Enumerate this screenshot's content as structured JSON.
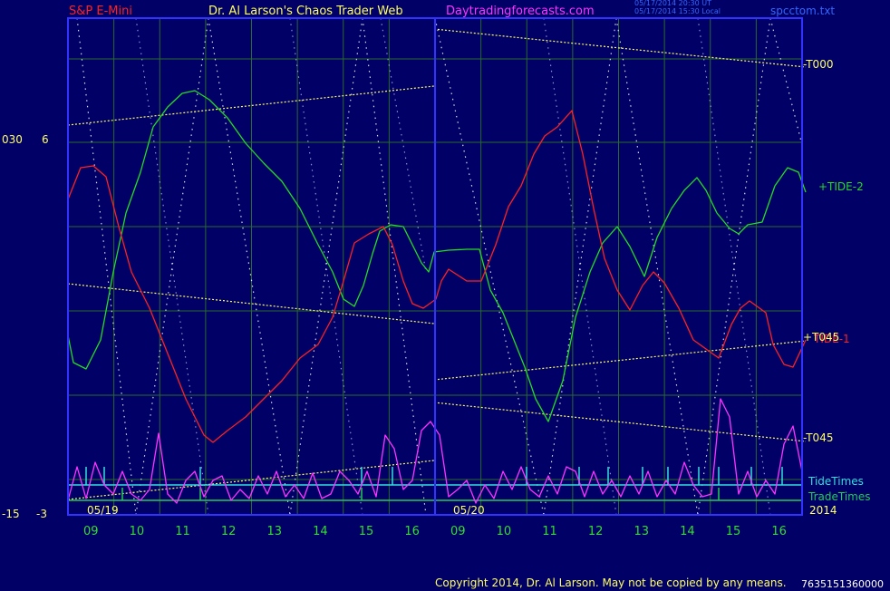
{
  "header": {
    "instrument": "S&P E-Mini",
    "source": "Dr. Al Larson's Chaos Trader Web",
    "site": "Daytradingforecasts.com",
    "stamp_line1": "05/17/2014 20:30 UT",
    "stamp_line2": "05/17/2014 15:30 Local",
    "file": "spcctom.txt"
  },
  "footer": {
    "copyright": "Copyright 2014, Dr. Al Larson. May not be copied by any means.",
    "code": "7635151360000"
  },
  "axis": {
    "left_top_a": "030",
    "left_top_b": "6",
    "left_bot_a": "-15",
    "left_bot_b": "-3",
    "year": "2014",
    "dates": [
      "05/19",
      "05/20"
    ]
  },
  "colors": {
    "background": "#000066",
    "frame": "#3333ff",
    "grid": "#2a6a2a",
    "tide1": "#ff2020",
    "tide2": "#22dd22",
    "eforce": "#ff33ff",
    "tidetimes": "#33dddd",
    "tradetimes": "#22cc55",
    "channel": "#ffff66"
  },
  "chart_data": {
    "type": "line",
    "x_ticks": [
      "09",
      "10",
      "11",
      "12",
      "13",
      "14",
      "15",
      "16",
      "09",
      "10",
      "11",
      "12",
      "13",
      "14",
      "15",
      "16"
    ],
    "x_hours": [
      8.5,
      9.5,
      10.5,
      11.5,
      12.5,
      13.5,
      14.5,
      15.5,
      16.5,
      17.5,
      18.5,
      19.5,
      20.5,
      21.5,
      22.5,
      23.5,
      24.5
    ],
    "labels": {
      "t000": "-T000",
      "tide2": "+TIDE-2",
      "tide1": "TIDE-1",
      "t045p": "+T045",
      "t045m": "-T045",
      "tidetimes": "TideTimes",
      "tradetimes": "TradeTimes"
    },
    "series": [
      {
        "name": "+TIDE-2",
        "color": "#22dd22",
        "points": [
          [
            0,
            370
          ],
          [
            0.3,
            400
          ],
          [
            1,
            407
          ],
          [
            1.8,
            375
          ],
          [
            2.5,
            300
          ],
          [
            3.2,
            235
          ],
          [
            4,
            190
          ],
          [
            4.7,
            140
          ],
          [
            5.5,
            118
          ],
          [
            6.3,
            103
          ],
          [
            7,
            100
          ],
          [
            7.8,
            110
          ],
          [
            8.8,
            130
          ],
          [
            9.8,
            158
          ],
          [
            10.8,
            180
          ],
          [
            11.8,
            200
          ],
          [
            12.8,
            230
          ],
          [
            13.8,
            270
          ],
          [
            14.6,
            300
          ],
          [
            15.2,
            330
          ],
          [
            15.8,
            338
          ],
          [
            16.3,
            315
          ],
          [
            16.8,
            280
          ],
          [
            17.2,
            255
          ],
          [
            17.8,
            248
          ],
          [
            18.5,
            250
          ],
          [
            19,
            270
          ],
          [
            19.5,
            290
          ],
          [
            19.9,
            300
          ],
          [
            20.2,
            278
          ],
          [
            21,
            276
          ],
          [
            22,
            275
          ],
          [
            22.7,
            275
          ],
          [
            23.3,
            320
          ],
          [
            24,
            345
          ],
          [
            24.6,
            375
          ],
          [
            25.2,
            405
          ],
          [
            25.8,
            440
          ],
          [
            26.5,
            465
          ],
          [
            27.3,
            420
          ],
          [
            28,
            350
          ],
          [
            28.8,
            300
          ],
          [
            29.5,
            268
          ],
          [
            30.3,
            250
          ],
          [
            31,
            272
          ],
          [
            31.8,
            305
          ],
          [
            32.5,
            262
          ],
          [
            33.3,
            230
          ],
          [
            34,
            210
          ],
          [
            34.7,
            196
          ],
          [
            35.2,
            210
          ],
          [
            35.8,
            235
          ],
          [
            36.5,
            252
          ],
          [
            37,
            258
          ],
          [
            37.5,
            248
          ],
          [
            38.3,
            245
          ],
          [
            39,
            205
          ],
          [
            39.7,
            185
          ],
          [
            40.3,
            190
          ],
          [
            40.7,
            212
          ]
        ]
      },
      {
        "name": "TIDE-1",
        "color": "#ff2020",
        "points": [
          [
            0,
            220
          ],
          [
            0.7,
            185
          ],
          [
            1.4,
            183
          ],
          [
            2.1,
            195
          ],
          [
            2.8,
            250
          ],
          [
            3.5,
            300
          ],
          [
            4.5,
            340
          ],
          [
            5.5,
            390
          ],
          [
            6.5,
            440
          ],
          [
            7.5,
            480
          ],
          [
            8,
            488
          ],
          [
            8.8,
            475
          ],
          [
            9.8,
            460
          ],
          [
            10.8,
            440
          ],
          [
            11.8,
            420
          ],
          [
            12.8,
            395
          ],
          [
            13.8,
            380
          ],
          [
            14.6,
            350
          ],
          [
            15.2,
            310
          ],
          [
            15.8,
            268
          ],
          [
            16.6,
            258
          ],
          [
            17.4,
            250
          ],
          [
            17.9,
            270
          ],
          [
            18.5,
            310
          ],
          [
            19,
            335
          ],
          [
            19.6,
            340
          ],
          [
            20.3,
            330
          ],
          [
            20.6,
            310
          ],
          [
            21,
            297
          ],
          [
            22,
            310
          ],
          [
            22.8,
            310
          ],
          [
            23.6,
            270
          ],
          [
            24.3,
            228
          ],
          [
            25,
            205
          ],
          [
            25.7,
            170
          ],
          [
            26.3,
            150
          ],
          [
            27,
            140
          ],
          [
            27.8,
            122
          ],
          [
            28.4,
            170
          ],
          [
            29,
            230
          ],
          [
            29.6,
            285
          ],
          [
            30.3,
            320
          ],
          [
            31,
            342
          ],
          [
            31.7,
            315
          ],
          [
            32.3,
            300
          ],
          [
            32.9,
            312
          ],
          [
            33.7,
            340
          ],
          [
            34.5,
            375
          ],
          [
            35.2,
            385
          ],
          [
            35.9,
            395
          ],
          [
            36.6,
            358
          ],
          [
            37.1,
            340
          ],
          [
            37.6,
            332
          ],
          [
            38.5,
            345
          ],
          [
            38.9,
            380
          ],
          [
            39.5,
            402
          ],
          [
            40,
            405
          ],
          [
            40.7,
            375
          ]
        ]
      },
      {
        "name": "E-Force",
        "color": "#ff33ff",
        "points": [
          [
            0,
            552
          ],
          [
            0.5,
            515
          ],
          [
            1,
            550
          ],
          [
            1.5,
            510
          ],
          [
            2,
            535
          ],
          [
            2.5,
            545
          ],
          [
            3,
            520
          ],
          [
            3.5,
            545
          ],
          [
            4,
            552
          ],
          [
            4.5,
            540
          ],
          [
            5,
            478
          ],
          [
            5.5,
            545
          ],
          [
            6,
            555
          ],
          [
            6.5,
            530
          ],
          [
            7,
            520
          ],
          [
            7.5,
            548
          ],
          [
            8,
            530
          ],
          [
            8.5,
            525
          ],
          [
            9,
            552
          ],
          [
            9.5,
            540
          ],
          [
            10,
            550
          ],
          [
            10.5,
            525
          ],
          [
            11,
            545
          ],
          [
            11.5,
            520
          ],
          [
            12,
            548
          ],
          [
            12.5,
            535
          ],
          [
            13,
            550
          ],
          [
            13.5,
            522
          ],
          [
            14,
            550
          ],
          [
            14.5,
            545
          ],
          [
            15,
            520
          ],
          [
            15.5,
            530
          ],
          [
            16,
            545
          ],
          [
            16.5,
            520
          ],
          [
            17,
            548
          ],
          [
            17.5,
            480
          ],
          [
            18,
            495
          ],
          [
            18.5,
            540
          ],
          [
            19,
            530
          ],
          [
            19.5,
            475
          ],
          [
            20,
            465
          ],
          [
            20.5,
            480
          ],
          [
            21,
            548
          ],
          [
            21.5,
            540
          ],
          [
            22,
            530
          ],
          [
            22.5,
            555
          ],
          [
            23,
            535
          ],
          [
            23.5,
            550
          ],
          [
            24,
            520
          ],
          [
            24.5,
            540
          ],
          [
            25,
            515
          ],
          [
            25.5,
            540
          ],
          [
            26,
            548
          ],
          [
            26.5,
            525
          ],
          [
            27,
            545
          ],
          [
            27.5,
            515
          ],
          [
            28,
            520
          ],
          [
            28.5,
            548
          ],
          [
            29,
            520
          ],
          [
            29.5,
            545
          ],
          [
            30,
            530
          ],
          [
            30.5,
            548
          ],
          [
            31,
            525
          ],
          [
            31.5,
            545
          ],
          [
            32,
            520
          ],
          [
            32.5,
            548
          ],
          [
            33,
            530
          ],
          [
            33.5,
            545
          ],
          [
            34,
            510
          ],
          [
            34.5,
            535
          ],
          [
            35,
            548
          ],
          [
            35.5,
            545
          ],
          [
            36,
            440
          ],
          [
            36.5,
            460
          ],
          [
            37,
            545
          ],
          [
            37.5,
            520
          ],
          [
            38,
            548
          ],
          [
            38.5,
            530
          ],
          [
            39,
            545
          ],
          [
            39.5,
            490
          ],
          [
            40,
            470
          ],
          [
            40.5,
            520
          ]
        ]
      }
    ],
    "channels": [
      [
        [
          0,
          138
        ],
        [
          20.2,
          95
        ]
      ],
      [
        [
          0,
          313
        ],
        [
          20.2,
          357
        ]
      ],
      [
        [
          0,
          551
        ],
        [
          20.2,
          508
        ]
      ],
      [
        [
          20.2,
          32
        ],
        [
          40.7,
          74
        ]
      ],
      [
        [
          20.2,
          419
        ],
        [
          40.7,
          376
        ]
      ],
      [
        [
          20.2,
          444
        ],
        [
          40.7,
          487
        ]
      ]
    ],
    "tide_times": [
      1,
      2,
      7.3,
      16.2,
      17.9,
      25.3,
      28.2,
      29.8,
      31.7,
      33.1,
      34.8,
      35.9,
      37.7,
      39.4
    ],
    "trade_times": [
      3,
      7.3,
      16.2,
      35.9
    ]
  }
}
